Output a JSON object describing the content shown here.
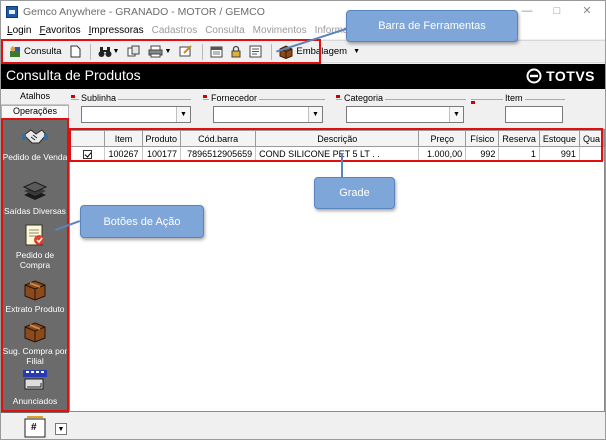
{
  "window": {
    "title": "Gemco Anywhere - GRANADO - MOTOR / GEMCO",
    "minimize": "—",
    "maximize": "□",
    "close": "✕"
  },
  "menu": [
    {
      "label": "Login",
      "disabled": false
    },
    {
      "label": "Favoritos",
      "disabled": false
    },
    {
      "label": "Impressoras",
      "disabled": false
    },
    {
      "label": "Cadastros",
      "disabled": true
    },
    {
      "label": "Consulta",
      "disabled": true
    },
    {
      "label": "Movimentos",
      "disabled": true
    },
    {
      "label": "Informaç",
      "disabled": true
    }
  ],
  "toolbar": {
    "consulta_label": "Consulta",
    "embalagem_label": "Embalagem"
  },
  "header": {
    "title": "Consulta de Produtos",
    "brand": "TOTVS"
  },
  "sidebar": {
    "tab_atalhos": "Atalhos",
    "tab_operacoes": "Operações",
    "actions": [
      {
        "label": "Pedido de Venda",
        "icon": "handshake-icon"
      },
      {
        "label": "Saídas Diversas",
        "icon": "stack-icon"
      },
      {
        "label": "Pedido de Compra",
        "icon": "order-form-icon"
      },
      {
        "label": "Extrato Produto",
        "icon": "box-icon"
      },
      {
        "label": "Sug. Compra por Filial",
        "icon": "box-icon"
      },
      {
        "label": "Anunciados",
        "icon": "advertise-icon"
      }
    ],
    "footer_value": "#"
  },
  "filters": {
    "sublinha": "Sublinha",
    "fornecedor": "Fornecedor",
    "categoria": "Categoria",
    "item": "Item"
  },
  "grid": {
    "columns": [
      "",
      "Item",
      "Produto",
      "Cód.barra",
      "Descrição",
      "Preço",
      "Físico",
      "Reserva",
      "Estoque",
      "Qua"
    ],
    "rows": [
      {
        "checked": true,
        "item": "100267",
        "produto": "100177",
        "cod_barra": "7896512905659",
        "descricao": "COND SILICONE PET 5 LT  . .",
        "preco": "1.000,00",
        "fisico": "992",
        "reserva": "1",
        "estoque": "991",
        "qua": ""
      }
    ]
  },
  "annotations": {
    "toolbar_callout": "Barra de Ferramentas",
    "grid_callout": "Grade",
    "actions_callout": "Botões de Ação",
    "highlight_color": "#e01010",
    "callout_color": "#7ea6d9"
  }
}
